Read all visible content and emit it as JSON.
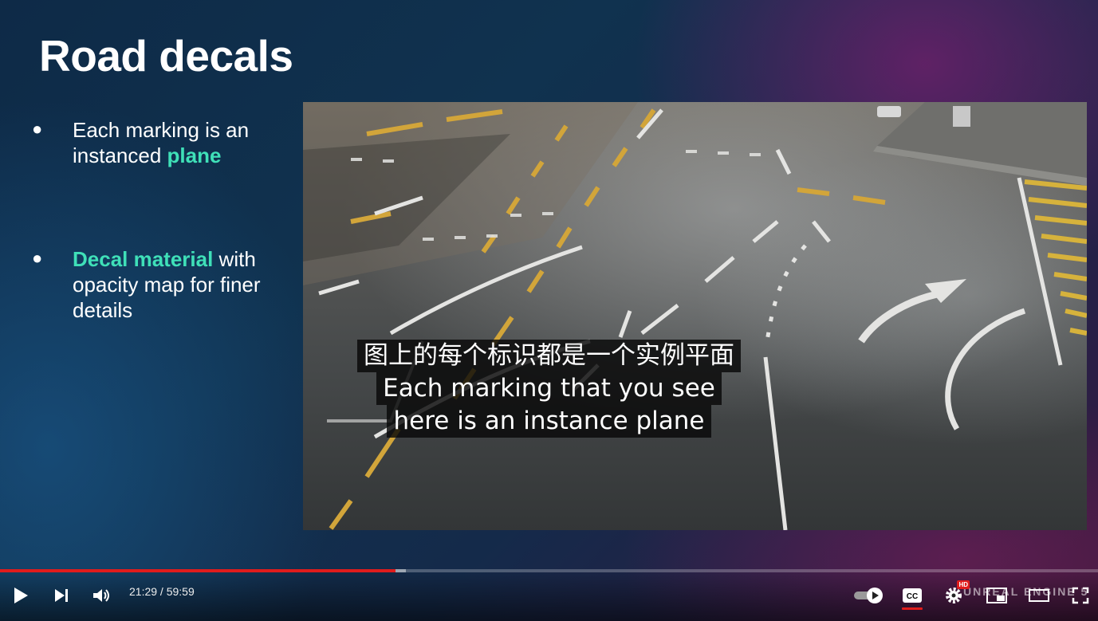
{
  "slide": {
    "title": "Road decals",
    "bullets": [
      {
        "dot": "●",
        "highlight_first": false,
        "pre": "Each marking is an instanced ",
        "highlight": "plane",
        "post": ""
      },
      {
        "dot": "●",
        "highlight_first": true,
        "pre": "",
        "highlight": "Decal material",
        "post": " with opacity map for finer details"
      }
    ],
    "highlight_color": "#3fe0b8"
  },
  "captions": {
    "lines": [
      "图上的每个标识都是一个实例平面",
      "Each marking that you see",
      "here is an instance plane"
    ]
  },
  "player": {
    "current_time": "21:29",
    "separator": " / ",
    "duration": "59:59",
    "progress_played_fraction": 0.3603,
    "progress_buffered_fraction": 0.37,
    "accent_color": "#e01c1c",
    "watermark": "UNREAL ENGINE 5",
    "quality_badge": "HD",
    "icons": [
      "play-icon",
      "next-icon",
      "volume-icon",
      "autoplay-toggle-icon",
      "captions-icon",
      "settings-icon",
      "miniplayer-icon",
      "theater-mode-icon",
      "fullscreen-icon"
    ]
  }
}
